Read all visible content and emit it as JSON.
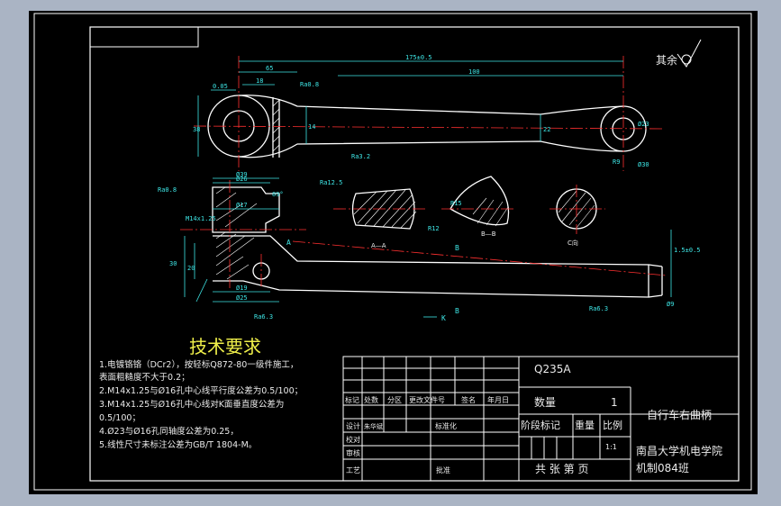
{
  "title_heading": "技术要求",
  "roughness_note": "其余",
  "tech_requirements": [
    "1.电镀铬铬（DCr2），按轻标Q872-80一级件施工，",
    "表面粗糙度不大于0.2；",
    "2.M14x1.25与Ø16孔中心线平行度公差为0.5/100；",
    "3.M14x1.25与Ø16孔中心线对K面垂直度公差为",
    "0.5/100；",
    "4.Ø23与Ø16孔同轴度公差为0.25，",
    "5.线性尺寸未标注公差为GB/T 1804-M。"
  ],
  "title_block": {
    "material": "Q235A",
    "quantity_label": "数量",
    "quantity_value": "1",
    "part_name": "自行车右曲柄",
    "school_line1": "南昌大学机电学院",
    "school_line2": "机制084班",
    "stage_label": "阶段标记",
    "weight_label": "重量",
    "scale_label": "比例",
    "scale_value": "1:1",
    "sheet_text": "共 张 第 页",
    "header_cells": [
      "标记",
      "处数",
      "分区",
      "更改文件号",
      "签名",
      "年月日"
    ],
    "left_labels": [
      "设计",
      "校对",
      "审核",
      "工艺"
    ],
    "designer": "朱华斌",
    "standardize_label": "标准化",
    "approve_label": "批准"
  },
  "dimensions": {
    "d175": "175±0.5",
    "d100": "100",
    "d65": "65",
    "d18": "18",
    "d38": "38",
    "d14": "14",
    "d22": "22",
    "d30": "30",
    "d20": "20",
    "dR9": "R9",
    "d16": "Ø16",
    "d23": "Ø23",
    "d30b": "Ø30",
    "d39": "Ø39",
    "d17": "Ø17",
    "d9": "Ø9",
    "d26": "Ø26",
    "d19": "Ø19",
    "d25": "Ø25",
    "dM14": "M14x1.25",
    "ra08": "Ra0.8",
    "ra32": "Ra3.2",
    "ra125": "Ra12.5",
    "ra63": "Ra6.3",
    "ra08b": "Ra0.8",
    "tol": "1.5±0.5",
    "ang": "89°",
    "r15": "R15",
    "r12": "R12",
    "gd": "0.05",
    "sec_aa": "A—A",
    "sec_bb": "B—B",
    "sec_c": "C向",
    "lbl_a": "A",
    "lbl_b": "B",
    "lbl_k": "K",
    "lbl_c": "C"
  }
}
